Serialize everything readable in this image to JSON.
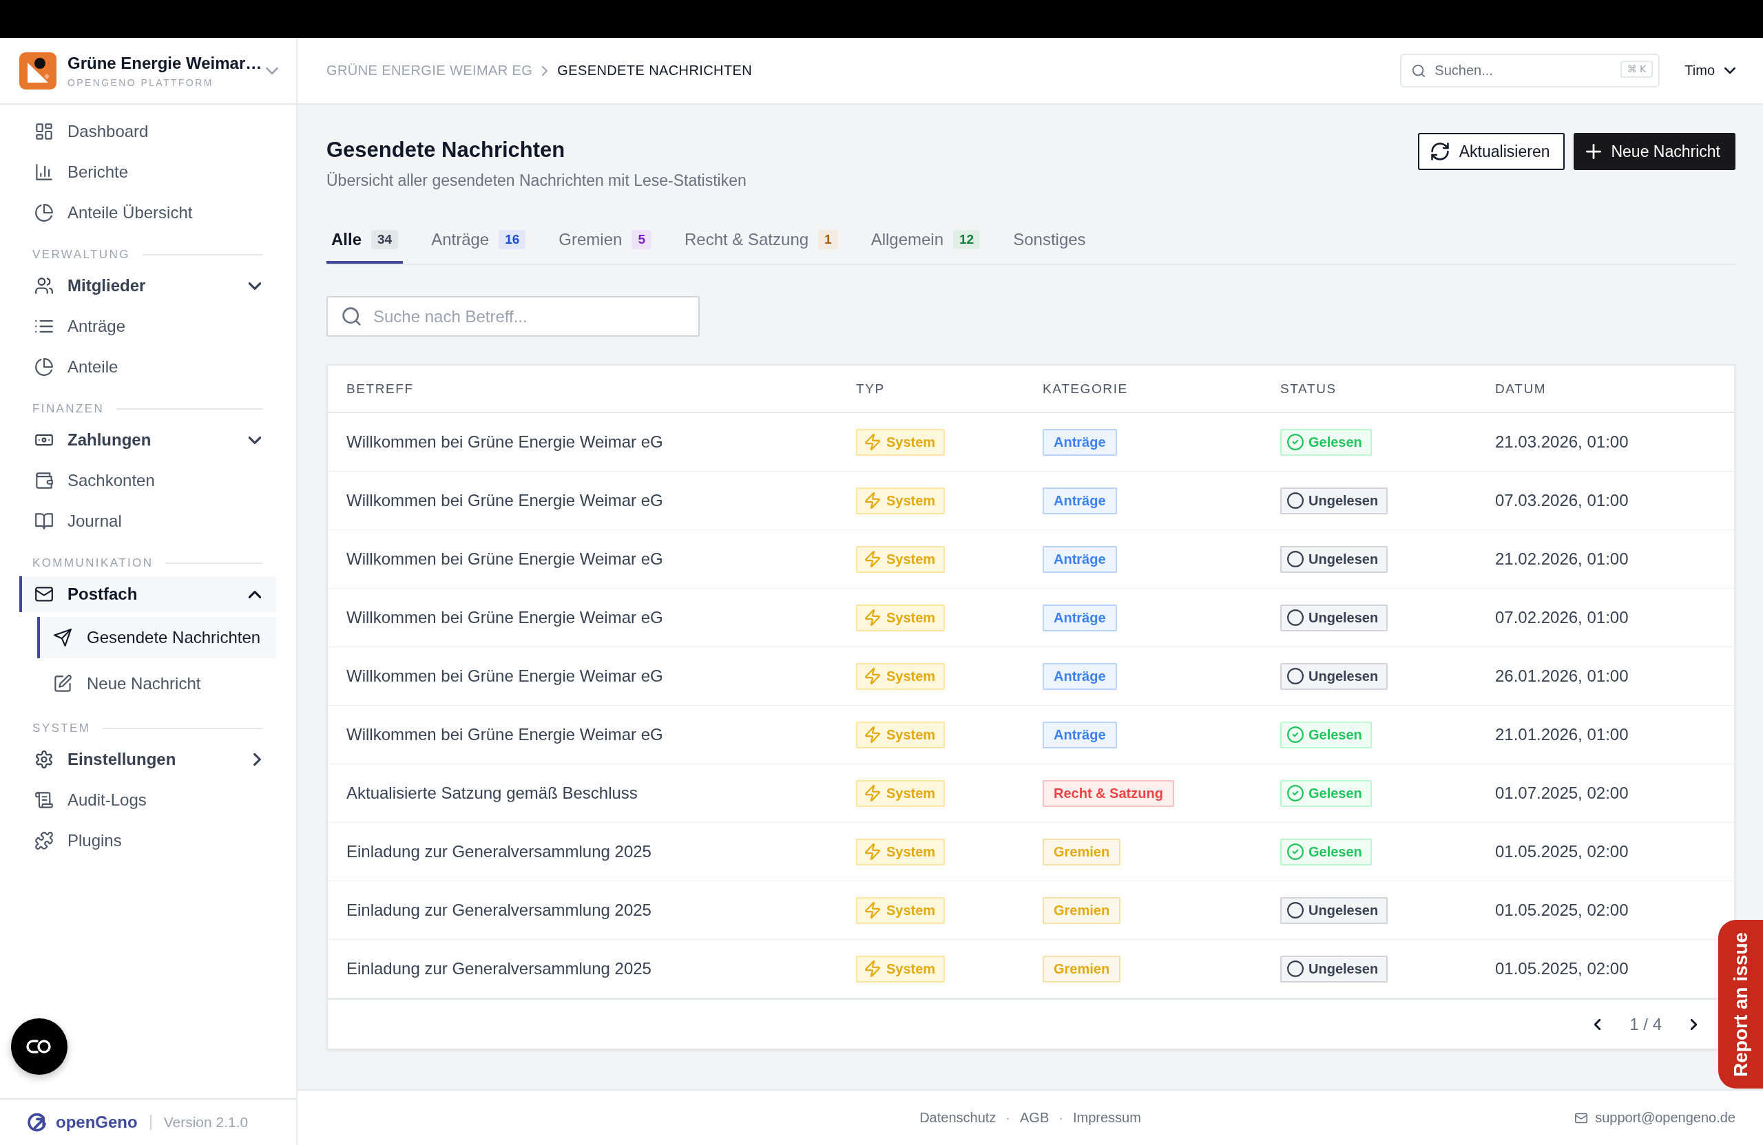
{
  "sidebar": {
    "organization": {
      "name": "Grüne Energie Weimar…",
      "subtitle": "OPENGENO PLATTFORM"
    },
    "sections": [
      {
        "items": [
          {
            "label": "Dashboard",
            "kind": "link",
            "selected": false
          },
          {
            "label": "Berichte",
            "kind": "link",
            "selected": false
          },
          {
            "label": "Anteile Übersicht",
            "kind": "link",
            "selected": false
          }
        ]
      },
      {
        "title": "VERWALTUNG",
        "items": [
          {
            "label": "Mitglieder",
            "kind": "group",
            "expanded": false,
            "selected": false
          },
          {
            "label": "Anträge",
            "kind": "link",
            "selected": false
          },
          {
            "label": "Anteile",
            "kind": "link",
            "selected": false
          }
        ]
      },
      {
        "title": "FINANZEN",
        "items": [
          {
            "label": "Zahlungen",
            "kind": "group",
            "expanded": false,
            "selected": false
          },
          {
            "label": "Sachkonten",
            "kind": "link",
            "selected": false
          },
          {
            "label": "Journal",
            "kind": "link",
            "selected": false
          }
        ]
      },
      {
        "title": "KOMMUNIKATION",
        "items": [
          {
            "label": "Postfach",
            "kind": "group",
            "expanded": true,
            "selected": true,
            "children": [
              {
                "label": "Gesendete Nachrichten",
                "selected": true
              },
              {
                "label": "Neue Nachricht",
                "selected": false
              }
            ]
          }
        ]
      },
      {
        "title": "SYSTEM",
        "items": [
          {
            "label": "Einstellungen",
            "kind": "submenu",
            "selected": false
          },
          {
            "label": "Audit-Logs",
            "kind": "link",
            "selected": false
          },
          {
            "label": "Plugins",
            "kind": "link",
            "selected": false
          }
        ]
      }
    ],
    "footer": {
      "brand": "openGeno",
      "version": "Version 2.1.0"
    }
  },
  "header": {
    "breadcrumb": [
      "GRÜNE ENERGIE WEIMAR EG",
      "GESENDETE NACHRICHTEN"
    ],
    "search": {
      "placeholder": "Suchen...",
      "shortcut": "⌘ K"
    },
    "user": "Timo"
  },
  "page": {
    "title": "Gesendete Nachrichten",
    "subtitle": "Übersicht aller gesendeten Nachrichten mit Lese-Statistiken",
    "actions": [
      {
        "label": "Aktualisieren",
        "kind": "outline"
      },
      {
        "label": "Neue Nachricht",
        "kind": "solid"
      }
    ]
  },
  "tabs": [
    {
      "label": "Alle",
      "count": "34",
      "color": "#374151",
      "selected": true
    },
    {
      "label": "Anträge",
      "count": "16",
      "color": "#1d4ed8",
      "selected": false
    },
    {
      "label": "Gremien",
      "count": "5",
      "color": "#7e22ce",
      "selected": false
    },
    {
      "label": "Recht & Satzung",
      "count": "1",
      "color": "#a16207",
      "selected": false
    },
    {
      "label": "Allgemein",
      "count": "12",
      "color": "#15803d",
      "selected": false
    },
    {
      "label": "Sonstiges",
      "selected": false
    }
  ],
  "search": {
    "placeholder": "Suche nach Betreff..."
  },
  "table": {
    "columns": [
      "BETREFF",
      "TYP",
      "KATEGORIE",
      "STATUS",
      "DATUM"
    ],
    "rows": [
      {
        "subject": "Willkommen bei Grüne Energie Weimar eG",
        "type": "System",
        "category": {
          "label": "Anträge",
          "color": "#3b82f6"
        },
        "status": {
          "label": "Gelesen",
          "read": true
        },
        "date": "21.03.2026, 01:00"
      },
      {
        "subject": "Willkommen bei Grüne Energie Weimar eG",
        "type": "System",
        "category": {
          "label": "Anträge",
          "color": "#3b82f6"
        },
        "status": {
          "label": "Ungelesen",
          "read": false
        },
        "date": "07.03.2026, 01:00"
      },
      {
        "subject": "Willkommen bei Grüne Energie Weimar eG",
        "type": "System",
        "category": {
          "label": "Anträge",
          "color": "#3b82f6"
        },
        "status": {
          "label": "Ungelesen",
          "read": false
        },
        "date": "21.02.2026, 01:00"
      },
      {
        "subject": "Willkommen bei Grüne Energie Weimar eG",
        "type": "System",
        "category": {
          "label": "Anträge",
          "color": "#3b82f6"
        },
        "status": {
          "label": "Ungelesen",
          "read": false
        },
        "date": "07.02.2026, 01:00"
      },
      {
        "subject": "Willkommen bei Grüne Energie Weimar eG",
        "type": "System",
        "category": {
          "label": "Anträge",
          "color": "#3b82f6"
        },
        "status": {
          "label": "Ungelesen",
          "read": false
        },
        "date": "26.01.2026, 01:00"
      },
      {
        "subject": "Willkommen bei Grüne Energie Weimar eG",
        "type": "System",
        "category": {
          "label": "Anträge",
          "color": "#3b82f6"
        },
        "status": {
          "label": "Gelesen",
          "read": true
        },
        "date": "21.01.2026, 01:00"
      },
      {
        "subject": "Aktualisierte Satzung gemäß Beschluss",
        "type": "System",
        "category": {
          "label": "Recht & Satzung",
          "color": "#ef4444"
        },
        "status": {
          "label": "Gelesen",
          "read": true
        },
        "date": "01.07.2025, 02:00"
      },
      {
        "subject": "Einladung zur Generalversammlung 2025",
        "type": "System",
        "category": {
          "label": "Gremien",
          "color": "#e5a90b"
        },
        "status": {
          "label": "Gelesen",
          "read": true
        },
        "date": "01.05.2025, 02:00"
      },
      {
        "subject": "Einladung zur Generalversammlung 2025",
        "type": "System",
        "category": {
          "label": "Gremien",
          "color": "#e5a90b"
        },
        "status": {
          "label": "Ungelesen",
          "read": false
        },
        "date": "01.05.2025, 02:00"
      },
      {
        "subject": "Einladung zur Generalversammlung 2025",
        "type": "System",
        "category": {
          "label": "Gremien",
          "color": "#e5a90b"
        },
        "status": {
          "label": "Ungelesen",
          "read": false
        },
        "date": "01.05.2025, 02:00"
      }
    ]
  },
  "pagination": {
    "label": "1 / 4"
  },
  "footer": {
    "links": [
      "Datenschutz",
      "AGB",
      "Impressum"
    ],
    "separator": "·",
    "email": "support@opengeno.de"
  },
  "report_button": "Report an issue"
}
